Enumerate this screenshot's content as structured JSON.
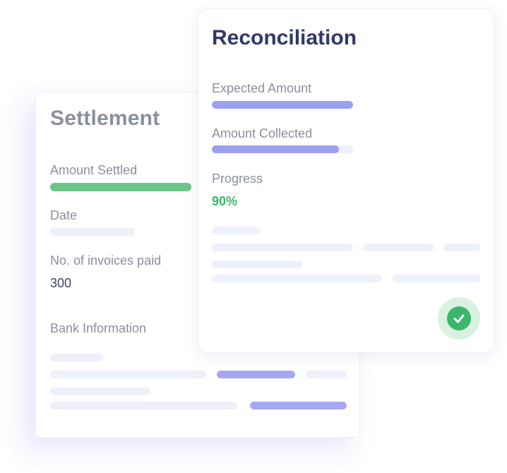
{
  "settlement": {
    "title": "Settlement",
    "amount_settled_label": "Amount Settled",
    "date_label": "Date",
    "invoices_label": "No. of invoices paid",
    "invoices_value": "300",
    "bank_info_label": "Bank Information"
  },
  "reconciliation": {
    "title": "Reconciliation",
    "expected_label": "Expected Amount",
    "expected_fill": 1.0,
    "collected_label": "Amount Collected",
    "collected_fill": 0.9,
    "progress_label": "Progress",
    "progress_value": "90%",
    "status_icon": "checkmark-icon"
  },
  "colors": {
    "accent": "#9c9ff0",
    "success": "#3cb66a",
    "settled_bar": "#6cc487",
    "title_dark": "#323868",
    "title_muted": "#8a8f9f"
  }
}
